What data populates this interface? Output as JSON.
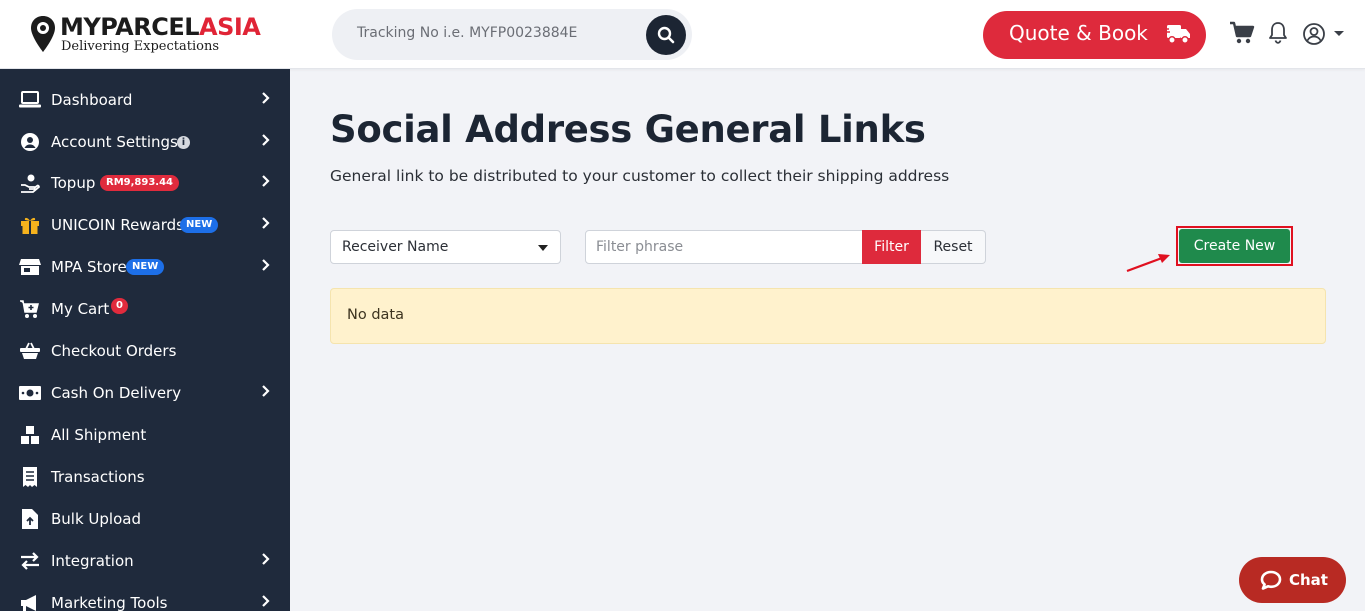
{
  "header": {
    "logo_main": "MYPARCEL",
    "logo_accent": "ASIA",
    "logo_tagline": "Delivering Expectations",
    "search_placeholder": "Tracking No i.e. MYFP0023884E",
    "quote_label": "Quote & Book"
  },
  "sidebar": {
    "items": [
      {
        "label": "Dashboard",
        "icon": "laptop-icon",
        "chevron": true
      },
      {
        "label": "Account Settings",
        "icon": "user-circle-icon",
        "chevron": true,
        "info": "i"
      },
      {
        "label": "Topup",
        "icon": "hand-coin-icon",
        "chevron": true,
        "badge": "RM9,893.44"
      },
      {
        "label": "UNICOIN Rewards",
        "icon": "gift-icon",
        "chevron": true,
        "badge": "NEW"
      },
      {
        "label": "MPA Store",
        "icon": "store-icon",
        "chevron": true,
        "badge": "NEW"
      },
      {
        "label": "My Cart",
        "icon": "cart-icon",
        "chevron": false,
        "badge": "0"
      },
      {
        "label": "Checkout Orders",
        "icon": "basket-icon",
        "chevron": false
      },
      {
        "label": "Cash On Delivery",
        "icon": "money-icon",
        "chevron": true
      },
      {
        "label": "All Shipment",
        "icon": "boxes-icon",
        "chevron": false
      },
      {
        "label": "Transactions",
        "icon": "receipt-icon",
        "chevron": false
      },
      {
        "label": "Bulk Upload",
        "icon": "upload-file-icon",
        "chevron": false
      },
      {
        "label": "Integration",
        "icon": "exchange-icon",
        "chevron": true
      },
      {
        "label": "Marketing Tools",
        "icon": "megaphone-icon",
        "chevron": true
      }
    ]
  },
  "main": {
    "title": "Social Address General Links",
    "subtitle": "General link to be distributed to your customer to collect their shipping address",
    "filter_select": "Receiver Name",
    "filter_placeholder": "Filter phrase",
    "filter_button": "Filter",
    "reset_button": "Reset",
    "create_button": "Create New",
    "empty_message": "No data"
  },
  "chat": {
    "label": "Chat"
  },
  "colors": {
    "brand_red": "#de2a3c",
    "sidebar_bg": "#1f2a3c",
    "create_green": "#1f8a4c",
    "chat_bg": "#b82a23"
  }
}
